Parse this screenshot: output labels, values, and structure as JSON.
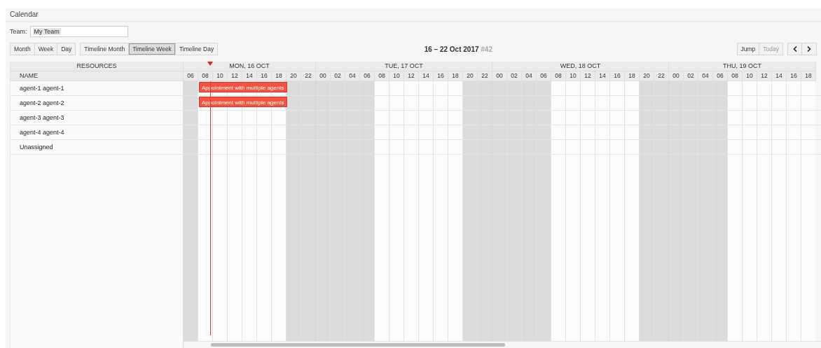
{
  "window": {
    "title": "Calendar"
  },
  "team": {
    "label": "Team:",
    "value": "My Team"
  },
  "view_groups": [
    [
      {
        "label": "Month",
        "selected": false
      },
      {
        "label": "Week",
        "selected": false
      },
      {
        "label": "Day",
        "selected": false
      }
    ],
    [
      {
        "label": "Timeline Month",
        "selected": false
      },
      {
        "label": "Timeline Week",
        "selected": true
      },
      {
        "label": "Timeline Day",
        "selected": false
      }
    ]
  ],
  "range_title": {
    "dates": "16 – 22 Oct 2017",
    "week": "#42"
  },
  "nav_buttons": [
    {
      "label": "Jump",
      "disabled": false
    },
    {
      "label": "Today",
      "disabled": true
    }
  ],
  "resources_header": "RESOURCES",
  "name_header": "NAME",
  "days": [
    {
      "label": "MON, 16 OCT",
      "hours": [
        {
          "label": "06",
          "off": true
        },
        {
          "label": "08",
          "off": false
        },
        {
          "label": "10",
          "off": false
        },
        {
          "label": "12",
          "off": false
        },
        {
          "label": "14",
          "off": false
        },
        {
          "label": "16",
          "off": false
        },
        {
          "label": "18",
          "off": false
        },
        {
          "label": "20",
          "off": true
        },
        {
          "label": "22",
          "off": true
        }
      ]
    },
    {
      "label": "TUE, 17 OCT",
      "hours": [
        {
          "label": "00",
          "off": true
        },
        {
          "label": "02",
          "off": true
        },
        {
          "label": "04",
          "off": true
        },
        {
          "label": "06",
          "off": true
        },
        {
          "label": "08",
          "off": false
        },
        {
          "label": "10",
          "off": false
        },
        {
          "label": "12",
          "off": false
        },
        {
          "label": "14",
          "off": false
        },
        {
          "label": "16",
          "off": false
        },
        {
          "label": "18",
          "off": false
        },
        {
          "label": "20",
          "off": true
        },
        {
          "label": "22",
          "off": true
        }
      ]
    },
    {
      "label": "WED, 18 OCT",
      "hours": [
        {
          "label": "00",
          "off": true
        },
        {
          "label": "02",
          "off": true
        },
        {
          "label": "04",
          "off": true
        },
        {
          "label": "06",
          "off": true
        },
        {
          "label": "08",
          "off": false
        },
        {
          "label": "10",
          "off": false
        },
        {
          "label": "12",
          "off": false
        },
        {
          "label": "14",
          "off": false
        },
        {
          "label": "16",
          "off": false
        },
        {
          "label": "18",
          "off": false
        },
        {
          "label": "20",
          "off": true
        },
        {
          "label": "22",
          "off": true
        }
      ]
    },
    {
      "label": "THU, 19 OCT",
      "hours": [
        {
          "label": "00",
          "off": true
        },
        {
          "label": "02",
          "off": true
        },
        {
          "label": "04",
          "off": true
        },
        {
          "label": "06",
          "off": true
        },
        {
          "label": "08",
          "off": false
        },
        {
          "label": "10",
          "off": false
        },
        {
          "label": "12",
          "off": false
        },
        {
          "label": "14",
          "off": false
        },
        {
          "label": "16",
          "off": false
        },
        {
          "label": "18",
          "off": false
        }
      ]
    }
  ],
  "now_marker": {
    "shown": true
  },
  "resources": [
    {
      "name": "agent-1 agent-1",
      "appointments": [
        {
          "title": "Appointment with multiple agents"
        }
      ]
    },
    {
      "name": "agent-2 agent-2",
      "appointments": [
        {
          "title": "Appointment with multiple agents"
        }
      ]
    },
    {
      "name": "agent-3 agent-3"
    },
    {
      "name": "agent-4 agent-4"
    },
    {
      "name": "Unassigned"
    }
  ]
}
